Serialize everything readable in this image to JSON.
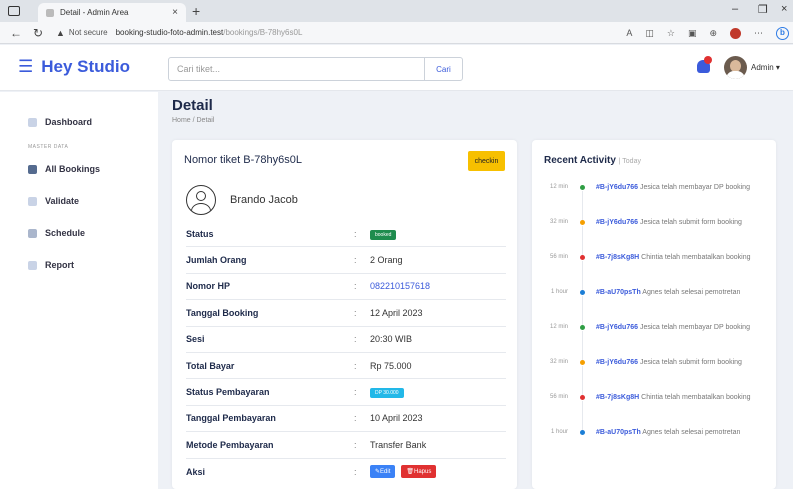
{
  "browser": {
    "tab_title": "Detail - Admin Area",
    "tab_close": "×",
    "new_tab": "+",
    "security_label": "Not secure",
    "url_host": "booking-studio-foto-admin.test",
    "url_path": "/bookings/B-78hy6s0L",
    "controls": {
      "minimize": "–",
      "maximize": "❐",
      "close": "×"
    }
  },
  "header": {
    "logo": "Hey Studio",
    "search": {
      "placeholder": "Cari tiket...",
      "button": "Cari"
    },
    "user_label": "Admin ▾"
  },
  "sidebar": {
    "section_label": "MASTER DATA",
    "items": [
      {
        "label": "Dashboard",
        "color": "#c9d3e6"
      },
      {
        "label": "All Bookings",
        "color": "#556b8f"
      },
      {
        "label": "Validate",
        "color": "#c9d3e6"
      },
      {
        "label": "Schedule",
        "color": "#aab6cc"
      },
      {
        "label": "Report",
        "color": "#c9d3e6"
      }
    ]
  },
  "page": {
    "title": "Detail",
    "breadcrumb": "Home / Detail"
  },
  "detail": {
    "ticket_label": "Nomor tiket B-78hy6s0L",
    "checkin_button": "checkin",
    "customer_name": "Brando Jacob",
    "rows": [
      {
        "key": "Status",
        "sep": ":",
        "pill": "booked"
      },
      {
        "key": "Jumlah Orang",
        "sep": ":",
        "value": "2 Orang"
      },
      {
        "key": "Nomor HP",
        "sep": ":",
        "value": "082210157618"
      },
      {
        "key": "Tanggal Booking",
        "sep": ":",
        "value": "12 April 2023"
      },
      {
        "key": "Sesi",
        "sep": ":",
        "value": "20:30 WIB"
      },
      {
        "key": "Total Bayar",
        "sep": ":",
        "value": "Rp 75.000"
      },
      {
        "key": "Status Pembayaran",
        "sep": ":",
        "pill": "DP 30.000"
      },
      {
        "key": "Tanggal Pembayaran",
        "sep": ":",
        "value": "10 April 2023"
      },
      {
        "key": "Metode Pembayaran",
        "sep": ":",
        "value": "Transfer Bank"
      },
      {
        "key": "Aksi",
        "sep": ":",
        "edit": "Edit",
        "delete": "Hapus"
      }
    ]
  },
  "activity": {
    "title": "Recent Activity",
    "subtitle": "| Today",
    "items": [
      {
        "time": "12 min",
        "id": "#B-jY6du766",
        "text": " Jesica telah membayar DP booking",
        "dot": "#2f9e44"
      },
      {
        "time": "32 min",
        "id": "#B-jY6du766",
        "text": " Jesica telah submit form booking",
        "dot": "#f59f00"
      },
      {
        "time": "56 min",
        "id": "#B-7j8sKg8H",
        "text": " Chintia telah membatalkan booking",
        "dot": "#e03131"
      },
      {
        "time": "1 hour",
        "id": "#B-aU70psTh",
        "text": " Agnes telah selesai pemotretan",
        "dot": "#1c7ed6"
      },
      {
        "time": "12 min",
        "id": "#B-jY6du766",
        "text": " Jesica telah membayar DP booking",
        "dot": "#2f9e44"
      },
      {
        "time": "32 min",
        "id": "#B-jY6du766",
        "text": " Jesica telah submit form booking",
        "dot": "#f59f00"
      },
      {
        "time": "56 min",
        "id": "#B-7j8sKg8H",
        "text": " Chintia telah membatalkan booking",
        "dot": "#e03131"
      },
      {
        "time": "1 hour",
        "id": "#B-aU70psTh",
        "text": " Agnes telah selesai pemotretan",
        "dot": "#1c7ed6"
      }
    ]
  }
}
